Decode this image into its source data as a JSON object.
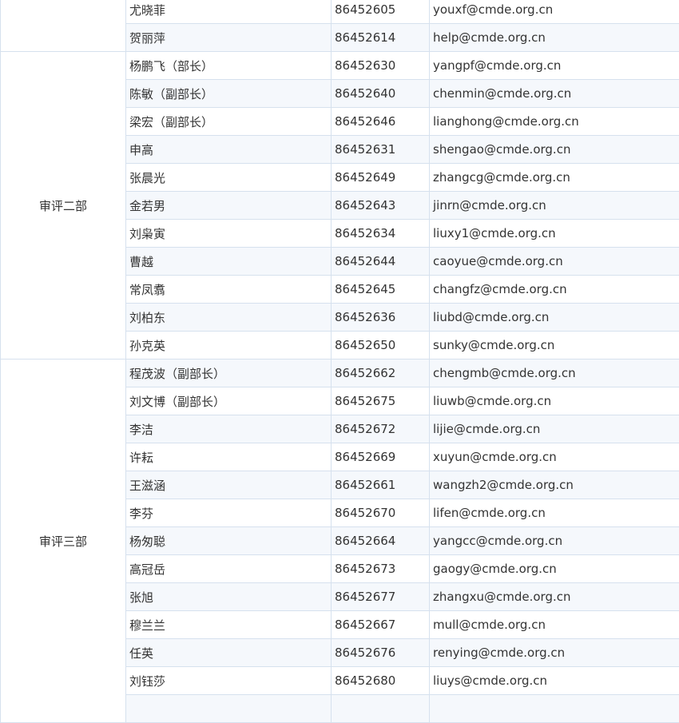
{
  "sections": [
    {
      "dept": "",
      "rows": [
        {
          "name": "尤晓菲",
          "phone": "86452605",
          "email": "youxf@cmde.org.cn"
        },
        {
          "name": "贺丽萍",
          "phone": "86452614",
          "email": "help@cmde.org.cn"
        }
      ]
    },
    {
      "dept": "审评二部",
      "rows": [
        {
          "name": "杨鹏飞（部长）",
          "phone": "86452630",
          "email": "yangpf@cmde.org.cn"
        },
        {
          "name": "陈敏（副部长）",
          "phone": "86452640",
          "email": "chenmin@cmde.org.cn"
        },
        {
          "name": "梁宏（副部长）",
          "phone": "86452646",
          "email": "lianghong@cmde.org.cn"
        },
        {
          "name": "申高",
          "phone": "86452631",
          "email": "shengao@cmde.org.cn"
        },
        {
          "name": "张晨光",
          "phone": "86452649",
          "email": "zhangcg@cmde.org.cn"
        },
        {
          "name": "金若男",
          "phone": "86452643",
          "email": "jinrn@cmde.org.cn"
        },
        {
          "name": "刘枭寅",
          "phone": "86452634",
          "email": "liuxy1@cmde.org.cn"
        },
        {
          "name": "曹越",
          "phone": "86452644",
          "email": "caoyue@cmde.org.cn"
        },
        {
          "name": "常凤翥",
          "phone": "86452645",
          "email": "changfz@cmde.org.cn"
        },
        {
          "name": "刘柏东",
          "phone": "86452636",
          "email": "liubd@cmde.org.cn"
        },
        {
          "name": "孙克英",
          "phone": "86452650",
          "email": "sunky@cmde.org.cn"
        }
      ]
    },
    {
      "dept": "审评三部",
      "rows": [
        {
          "name": "程茂波（副部长）",
          "phone": "86452662",
          "email": "chengmb@cmde.org.cn"
        },
        {
          "name": "刘文博（副部长）",
          "phone": "86452675",
          "email": "liuwb@cmde.org.cn"
        },
        {
          "name": "李洁",
          "phone": "86452672",
          "email": "lijie@cmde.org.cn"
        },
        {
          "name": "许耘",
          "phone": "86452669",
          "email": "xuyun@cmde.org.cn"
        },
        {
          "name": "王滋涵",
          "phone": "86452661",
          "email": "wangzh2@cmde.org.cn"
        },
        {
          "name": "李芬",
          "phone": "86452670",
          "email": "lifen@cmde.org.cn"
        },
        {
          "name": "杨匆聪",
          "phone": "86452664",
          "email": "yangcc@cmde.org.cn"
        },
        {
          "name": "高冠岳",
          "phone": "86452673",
          "email": "gaogy@cmde.org.cn"
        },
        {
          "name": "张旭",
          "phone": "86452677",
          "email": "zhangxu@cmde.org.cn"
        },
        {
          "name": "穆兰兰",
          "phone": "86452667",
          "email": "mull@cmde.org.cn"
        },
        {
          "name": "任英",
          "phone": "86452676",
          "email": "renying@cmde.org.cn"
        },
        {
          "name": "刘钰莎",
          "phone": "86452680",
          "email": "liuys@cmde.org.cn"
        },
        {
          "name": "",
          "phone": "",
          "email": ""
        }
      ]
    }
  ]
}
